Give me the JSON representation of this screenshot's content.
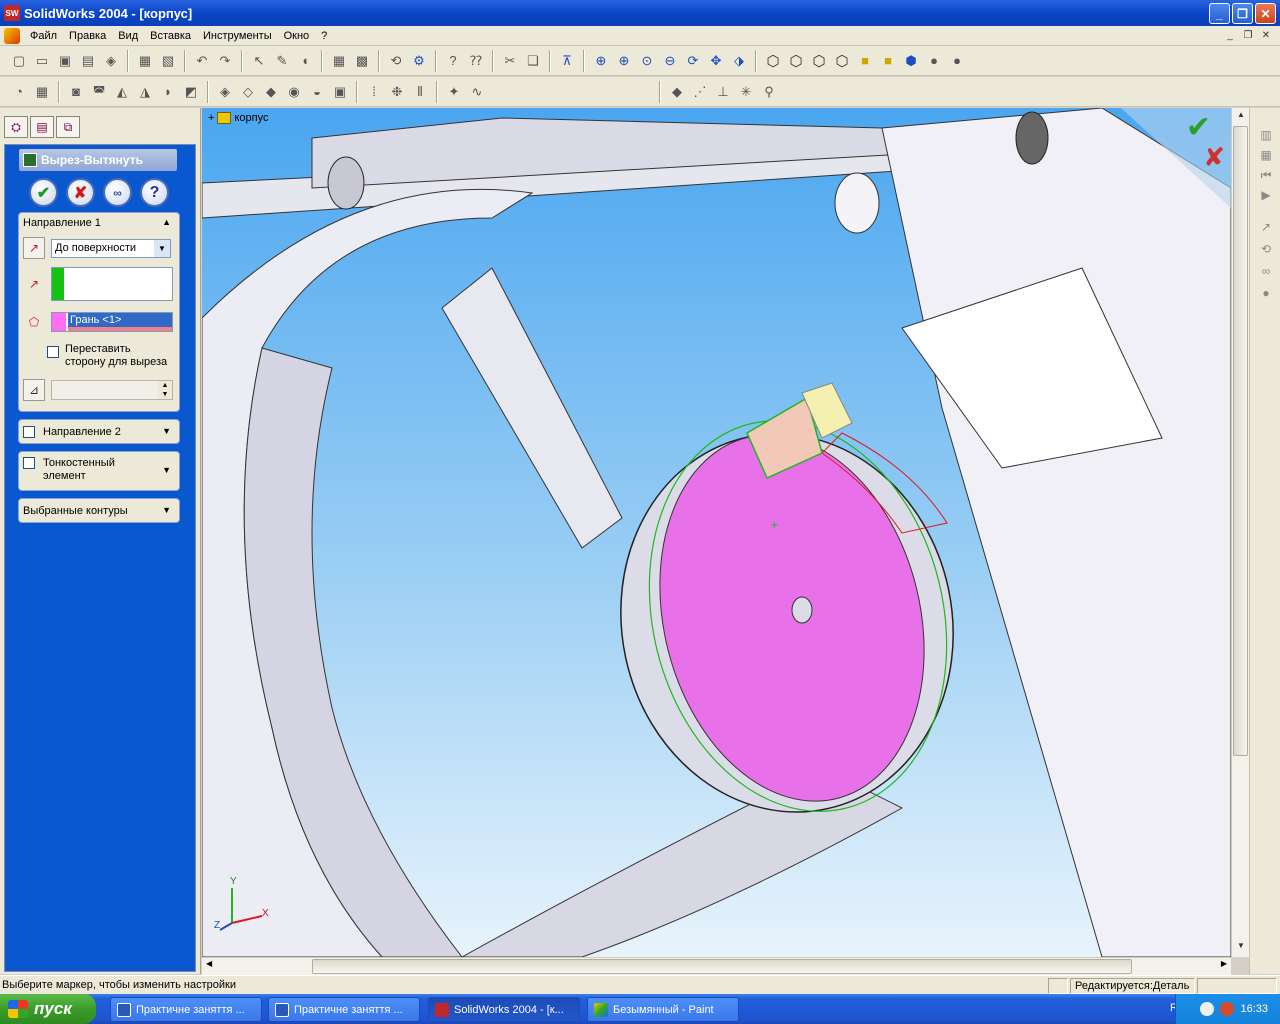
{
  "window": {
    "title": "SolidWorks 2004 - [корпус]",
    "app_icon": "solidworks-logo-icon",
    "app_icon_text": "SW",
    "minimize": "_",
    "maximize": "❐",
    "close": "✕"
  },
  "menu": {
    "items": [
      "Файл",
      "Правка",
      "Вид",
      "Вставка",
      "Инструменты",
      "Окно",
      "?"
    ],
    "mdi_minimize": "_",
    "mdi_restore": "❐",
    "mdi_close": "✕"
  },
  "property_manager": {
    "feature_title": "Вырез-Вытянуть",
    "ok": "✔",
    "cancel": "✘",
    "preview": "∞",
    "help": "?",
    "direction1": {
      "label": "Направление 1",
      "end_condition": "До поверхности",
      "face_selection": "Грань <1>",
      "flip_side_label_1": "Переставить",
      "flip_side_label_2": "сторону для выреза",
      "flip_checked": false
    },
    "direction2": {
      "label": "Направление 2",
      "checked": false
    },
    "thin_feature": {
      "label_1": "Тонкостенный",
      "label_2": "элемент",
      "checked": false
    },
    "selected_contours": {
      "label": "Выбранные контуры"
    }
  },
  "viewport": {
    "tree_root": "корпус",
    "confirm_ok": "✔",
    "confirm_cancel": "✘",
    "triad_x": "X",
    "triad_y": "Y",
    "triad_z": "Z",
    "colors": {
      "selected_face": "#e870e8",
      "preview_green": "#1cb81c",
      "preview_red": "#e01818",
      "model_gray": "#d8d8e4"
    }
  },
  "statusbar": {
    "message": "Выберите маркер, чтобы изменить настройки",
    "mode": "Редактируется:Деталь"
  },
  "taskbar": {
    "start": "пуск",
    "tasks": [
      {
        "label": "Практичне заняття ...",
        "icon": "word-icon"
      },
      {
        "label": "Практичне заняття ...",
        "icon": "word-icon"
      },
      {
        "label": "SolidWorks 2004 - [к...",
        "icon": "solidworks-icon",
        "active": true
      },
      {
        "label": "Безымянный - Paint",
        "icon": "paint-icon"
      }
    ],
    "language": "RU",
    "clock": "16:33"
  }
}
